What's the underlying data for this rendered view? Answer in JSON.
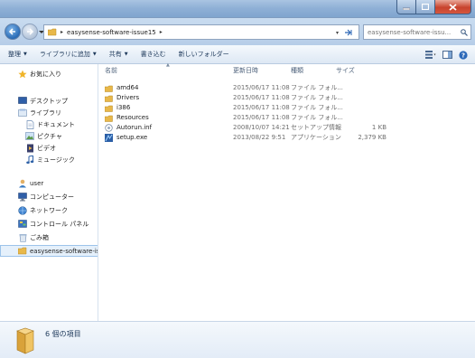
{
  "window": {
    "address": {
      "crumbs": [
        "easysense-software-issue15"
      ],
      "separator": "▸"
    },
    "search": {
      "placeholder": "easysense-software-issu..."
    }
  },
  "toolbar": {
    "organize": "整理",
    "add_to_library": "ライブラリに追加",
    "share": "共有",
    "burn": "書き込む",
    "new_folder": "新しいフォルダー"
  },
  "nav": {
    "favorites": "お気に入り",
    "desktop": "デスクトップ",
    "libraries": "ライブラリ",
    "documents": "ドキュメント",
    "pictures": "ピクチャ",
    "videos": "ビデオ",
    "music": "ミュージック",
    "user": "user",
    "computer": "コンピューター",
    "network": "ネットワーク",
    "control_panel": "コントロール パネル",
    "recycle_bin": "ごみ箱",
    "current_folder": "easysense-software-is"
  },
  "columns": {
    "name": "名前",
    "date": "更新日時",
    "type": "種類",
    "size": "サイズ"
  },
  "files": [
    {
      "name": "amd64",
      "date": "2015/06/17 11:08",
      "type": "ファイル フォル...",
      "size": "",
      "icon": "folder-icon"
    },
    {
      "name": "Drivers",
      "date": "2015/06/17 11:08",
      "type": "ファイル フォル...",
      "size": "",
      "icon": "folder-icon"
    },
    {
      "name": "i386",
      "date": "2015/06/17 11:08",
      "type": "ファイル フォル...",
      "size": "",
      "icon": "folder-icon"
    },
    {
      "name": "Resources",
      "date": "2015/06/17 11:08",
      "type": "ファイル フォル...",
      "size": "",
      "icon": "folder-icon"
    },
    {
      "name": "Autorun.inf",
      "date": "2008/10/07 14:21",
      "type": "セットアップ情報",
      "size": "1 KB",
      "icon": "setup-info-icon"
    },
    {
      "name": "setup.exe",
      "date": "2013/08/22 9:51",
      "type": "アプリケーション",
      "size": "2,379 KB",
      "icon": "application-icon"
    }
  ],
  "status": {
    "item_count": "6 個の項目"
  },
  "colors": {
    "titlebar": "#8fb0d6",
    "nav_selected": "#e5f0fb",
    "folder": "#e8b84a",
    "close_button": "#c8432d"
  }
}
